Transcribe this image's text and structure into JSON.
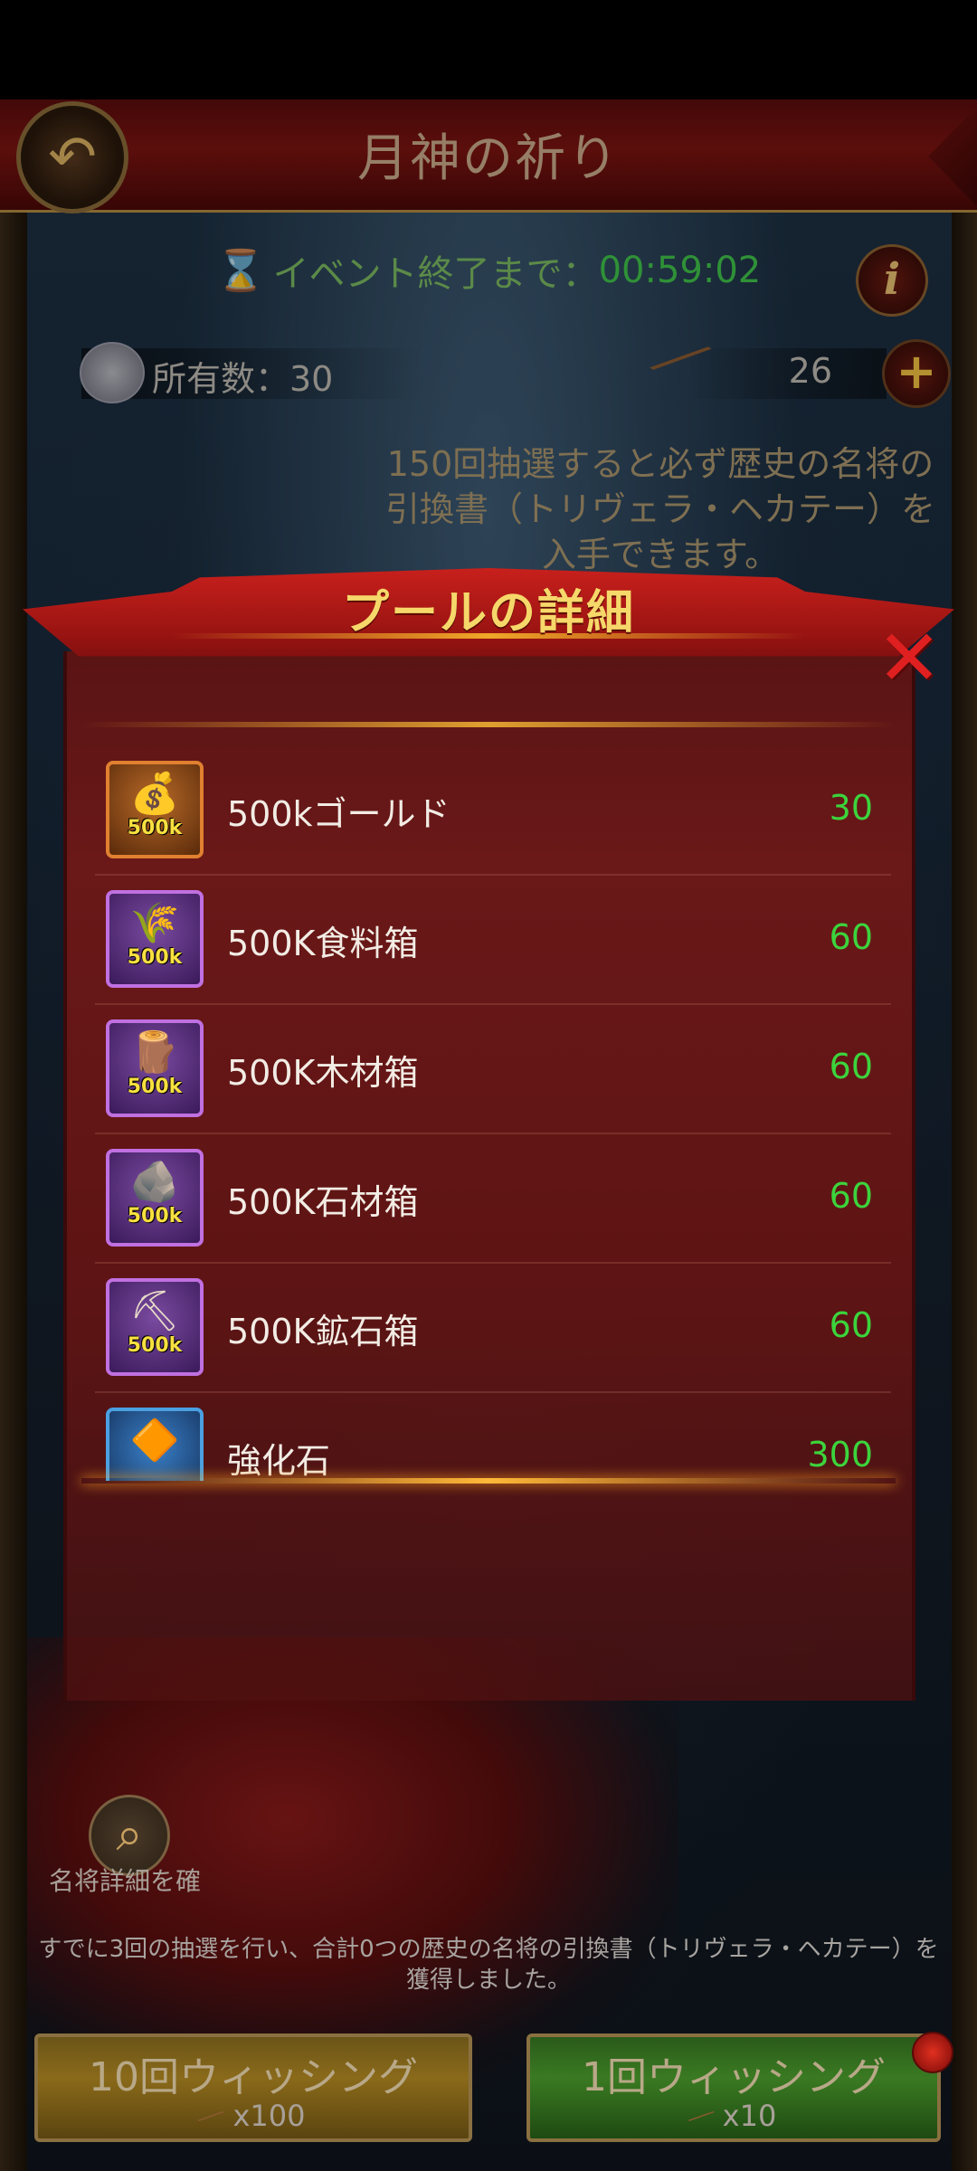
{
  "header": {
    "title": "月神の祈り"
  },
  "event": {
    "timer_label": "イベント終了まで：",
    "timer_value": "00:59:02"
  },
  "currency": {
    "owned_label": "所有数：30",
    "staff_count": "26"
  },
  "notice": "150回抽選すると必ず歴史の名将の引換書（トリヴェラ・ヘカテー）を入手できます。",
  "modal": {
    "title": "プールの詳細",
    "items": [
      {
        "name": "500kゴールド",
        "count": "30",
        "badge": "500k",
        "icon": "gold-coins-icon",
        "frame": "gold"
      },
      {
        "name": "500K食料箱",
        "count": "60",
        "badge": "500k",
        "icon": "wheat-icon",
        "frame": "purple"
      },
      {
        "name": "500K木材箱",
        "count": "60",
        "badge": "500k",
        "icon": "lumber-icon",
        "frame": "purple"
      },
      {
        "name": "500K石材箱",
        "count": "60",
        "badge": "500k",
        "icon": "stone-icon",
        "frame": "purple"
      },
      {
        "name": "500K鉱石箱",
        "count": "60",
        "badge": "500k",
        "icon": "ore-icon",
        "frame": "purple"
      },
      {
        "name": "強化石",
        "count": "300",
        "badge": "",
        "icon": "crystal-icon",
        "frame": "blue"
      }
    ]
  },
  "hero_detail_label": "名将詳細を確",
  "progress_text": "すでに3回の抽選を行い、合計0つの歴史の名将の引換書（トリヴェラ・ヘカテー）を獲得しました。",
  "buttons": {
    "wish10_label": "10回ウィッシング",
    "wish10_cost": "x100",
    "wish1_label": "1回ウィッシング",
    "wish1_cost": "x10"
  }
}
